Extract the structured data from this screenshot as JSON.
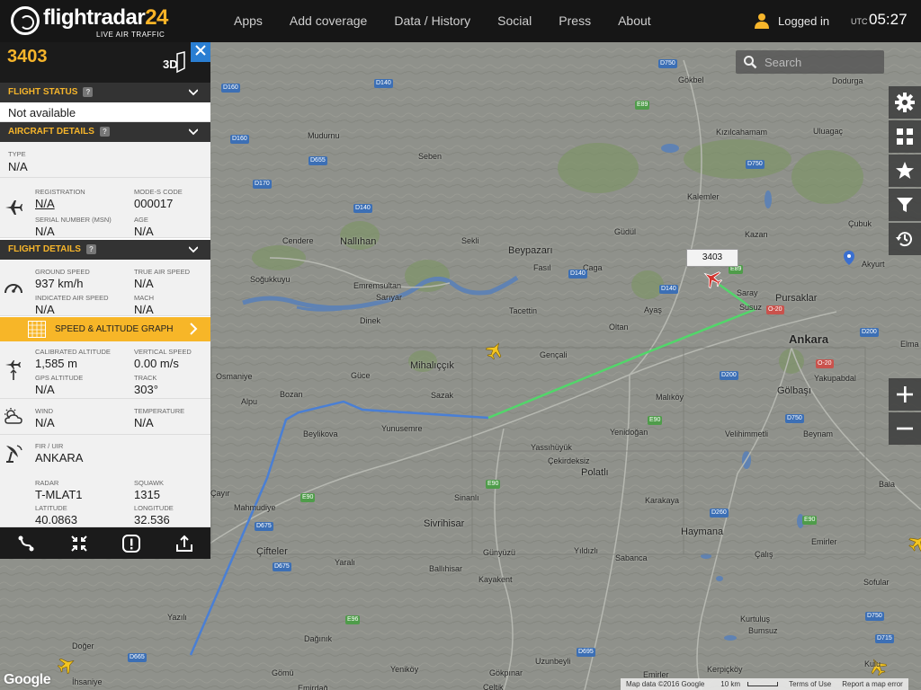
{
  "brand": {
    "name": "flightradar",
    "num": "24",
    "tagline": "LIVE AIR TRAFFIC"
  },
  "nav": [
    "Apps",
    "Add coverage",
    "Data / History",
    "Social",
    "Press",
    "About"
  ],
  "user": {
    "status": "Logged in"
  },
  "clock": {
    "label": "UTC",
    "time": "05:27"
  },
  "search": {
    "placeholder": "Search"
  },
  "panel": {
    "flight_id": "3403",
    "btn_3d": "3D",
    "flight_status": {
      "title": "FLIGHT STATUS",
      "value": "Not available"
    },
    "aircraft_details": {
      "title": "AIRCRAFT DETAILS",
      "type_label": "TYPE",
      "type_value": "N/A",
      "registration_label": "REGISTRATION",
      "registration_value": "N/A",
      "modes_label": "MODE-S CODE",
      "modes_value": "000017",
      "serial_label": "SERIAL NUMBER (MSN)",
      "serial_value": "N/A",
      "age_label": "AGE",
      "age_value": "N/A"
    },
    "flight_details": {
      "title": "FLIGHT DETAILS",
      "ground_speed_label": "GROUND SPEED",
      "ground_speed_value": "937 km/h",
      "true_air_speed_label": "TRUE AIR SPEED",
      "true_air_speed_value": "N/A",
      "ias_label": "INDICATED AIR SPEED",
      "ias_value": "N/A",
      "mach_label": "MACH",
      "mach_value": "N/A",
      "graph_label": "SPEED & ALTITUDE GRAPH",
      "cal_alt_label": "CALIBRATED ALTITUDE",
      "cal_alt_value": "1,585 m",
      "vs_label": "VERTICAL SPEED",
      "vs_value": "0.00 m/s",
      "gps_alt_label": "GPS ALTITUDE",
      "gps_alt_value": "N/A",
      "track_label": "TRACK",
      "track_value": "303°",
      "wind_label": "WIND",
      "wind_value": "N/A",
      "temp_label": "TEMPERATURE",
      "temp_value": "N/A",
      "fir_label": "FIR / UIR",
      "fir_value": "ANKARA",
      "radar_label": "RADAR",
      "radar_value": "T-MLAT1",
      "squawk_label": "SQUAWK",
      "squawk_value": "1315",
      "lat_label": "LATITUDE",
      "lat_value": "40.0863",
      "lon_label": "LONGITUDE",
      "lon_value": "32.536"
    }
  },
  "map": {
    "callsign_label": "3403",
    "places": [
      {
        "name": "Gökbel",
        "cls": ""
      },
      {
        "name": "Dodurga",
        "cls": ""
      },
      {
        "name": "Kızılcahamam",
        "cls": ""
      },
      {
        "name": "Uluagaç",
        "cls": ""
      },
      {
        "name": "Mudurnu",
        "cls": ""
      },
      {
        "name": "Seben",
        "cls": ""
      },
      {
        "name": "Kalemler",
        "cls": ""
      },
      {
        "name": "Çubuk",
        "cls": ""
      },
      {
        "name": "Güdül",
        "cls": ""
      },
      {
        "name": "Kazan",
        "cls": ""
      },
      {
        "name": "Cendere",
        "cls": ""
      },
      {
        "name": "Nallıhan",
        "cls": "mid"
      },
      {
        "name": "Sekli",
        "cls": ""
      },
      {
        "name": "Beypazarı",
        "cls": "mid"
      },
      {
        "name": "Fasıl",
        "cls": ""
      },
      {
        "name": "Çaga",
        "cls": ""
      },
      {
        "name": "Akyurt",
        "cls": ""
      },
      {
        "name": "Soğukkuyu",
        "cls": ""
      },
      {
        "name": "Emremsultan",
        "cls": ""
      },
      {
        "name": "Sarıyar",
        "cls": ""
      },
      {
        "name": "Saray",
        "cls": ""
      },
      {
        "name": "Pursaklar",
        "cls": "mid"
      },
      {
        "name": "Tacettin",
        "cls": ""
      },
      {
        "name": "Ayaş",
        "cls": ""
      },
      {
        "name": "Susuz",
        "cls": ""
      },
      {
        "name": "Dinek",
        "cls": ""
      },
      {
        "name": "Oltan",
        "cls": ""
      },
      {
        "name": "Ankara",
        "cls": "big"
      },
      {
        "name": "Elma",
        "cls": ""
      },
      {
        "name": "Gençali",
        "cls": ""
      },
      {
        "name": "Osmaniye",
        "cls": ""
      },
      {
        "name": "Mihalıççık",
        "cls": "mid"
      },
      {
        "name": "Güce",
        "cls": ""
      },
      {
        "name": "Yakupabdal",
        "cls": ""
      },
      {
        "name": "Malıköy",
        "cls": ""
      },
      {
        "name": "Alpu",
        "cls": ""
      },
      {
        "name": "Bozan",
        "cls": ""
      },
      {
        "name": "Sazak",
        "cls": ""
      },
      {
        "name": "Gölbaşı",
        "cls": "mid"
      },
      {
        "name": "Yunusemre",
        "cls": ""
      },
      {
        "name": "Beylikova",
        "cls": ""
      },
      {
        "name": "Yenidoğan",
        "cls": ""
      },
      {
        "name": "Velihimmetli",
        "cls": ""
      },
      {
        "name": "Beynam",
        "cls": ""
      },
      {
        "name": "Yassıhüyük",
        "cls": ""
      },
      {
        "name": "Çekirdeksiz",
        "cls": ""
      },
      {
        "name": "Polatlı",
        "cls": "mid"
      },
      {
        "name": "Bala",
        "cls": ""
      },
      {
        "name": "Çayır",
        "cls": ""
      },
      {
        "name": "Sinanlı",
        "cls": ""
      },
      {
        "name": "Mahmudiye",
        "cls": ""
      },
      {
        "name": "Sivrihisar",
        "cls": "mid"
      },
      {
        "name": "Karakaya",
        "cls": ""
      },
      {
        "name": "Haymana",
        "cls": "mid"
      },
      {
        "name": "Emirler",
        "cls": ""
      },
      {
        "name": "Çifteler",
        "cls": "mid"
      },
      {
        "name": "Yaralı",
        "cls": ""
      },
      {
        "name": "Ballıhisar",
        "cls": ""
      },
      {
        "name": "Günyüzü",
        "cls": ""
      },
      {
        "name": "Yıldızlı",
        "cls": ""
      },
      {
        "name": "Sabanca",
        "cls": ""
      },
      {
        "name": "Çalış",
        "cls": ""
      },
      {
        "name": "Sofular",
        "cls": ""
      },
      {
        "name": "Kayakent",
        "cls": ""
      },
      {
        "name": "Yazılı",
        "cls": ""
      },
      {
        "name": "Kurtuluş",
        "cls": ""
      },
      {
        "name": "Bumsuz",
        "cls": ""
      },
      {
        "name": "Doğer",
        "cls": ""
      },
      {
        "name": "Dağınık",
        "cls": ""
      },
      {
        "name": "Uzunbeyli",
        "cls": ""
      },
      {
        "name": "Gömü",
        "cls": ""
      },
      {
        "name": "Yeniköy",
        "cls": ""
      },
      {
        "name": "Gökpınar",
        "cls": ""
      },
      {
        "name": "Emirler",
        "cls": ""
      },
      {
        "name": "Kerpiçköy",
        "cls": ""
      },
      {
        "name": "Kulu",
        "cls": ""
      },
      {
        "name": "İhsaniye",
        "cls": ""
      },
      {
        "name": "Emirdağ",
        "cls": ""
      },
      {
        "name": "Çeltik",
        "cls": ""
      }
    ],
    "roads": [
      "D750",
      "D160",
      "D140",
      "E89",
      "D160",
      "D655",
      "D170",
      "D140",
      "D750",
      "E89",
      "D140",
      "D140",
      "O-20",
      "D200",
      "O-20",
      "D200",
      "E90",
      "D750",
      "E90",
      "E90",
      "D260",
      "E90",
      "D675",
      "D675",
      "E96",
      "D695",
      "D665",
      "D750",
      "D715"
    ]
  },
  "footer": {
    "google": "Google",
    "map_data": "Map data ©2016 Google",
    "scale": "10 km",
    "terms": "Terms of Use",
    "report": "Report a map error"
  },
  "colors": {
    "brand_yellow": "#f6b52b",
    "panel_dark": "#1b1b1b",
    "track_blue": "#4a7fd4",
    "track_green": "#52d66a",
    "aircraft_red": "#d2332d"
  }
}
